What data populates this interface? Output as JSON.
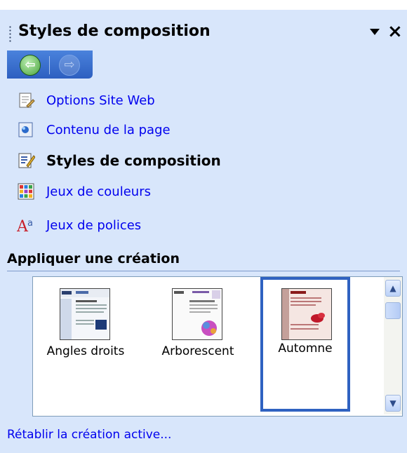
{
  "pane": {
    "title": "Styles de composition",
    "close_label": "×"
  },
  "nav": {
    "back_icon": "arrow-left-icon",
    "forward_icon": "arrow-right-icon"
  },
  "menu": {
    "items": [
      {
        "label": "Options Site Web",
        "icon": "site-options-icon",
        "active": false
      },
      {
        "label": "Contenu de la page",
        "icon": "page-content-icon",
        "active": false
      },
      {
        "label": "Styles de composition",
        "icon": "layout-styles-icon",
        "active": true
      },
      {
        "label": "Jeux de couleurs",
        "icon": "color-schemes-icon",
        "active": false
      },
      {
        "label": "Jeux de polices",
        "icon": "font-schemes-icon",
        "active": false
      }
    ]
  },
  "section": {
    "heading": "Appliquer une création"
  },
  "gallery": {
    "items": [
      {
        "label": "Angles droits",
        "selected": false
      },
      {
        "label": "Arborescent",
        "selected": false
      },
      {
        "label": "Automne",
        "selected": true
      }
    ]
  },
  "footer": {
    "reset_link": "Rétablir la création active..."
  },
  "colors": {
    "pane_bg": "#d8e6fb",
    "link": "#0000ee",
    "selection_border": "#2f62c1"
  }
}
